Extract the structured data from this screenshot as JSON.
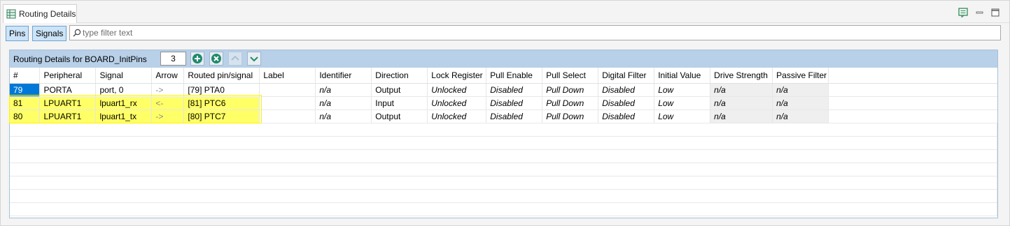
{
  "tab": {
    "title": "Routing Details"
  },
  "toolbar": {
    "pins_label": "Pins",
    "signals_label": "Signals",
    "filter_placeholder": "type filter text"
  },
  "panel": {
    "title": "Routing Details for BOARD_InitPins",
    "count": "3"
  },
  "columns": [
    "#",
    "Peripheral",
    "Signal",
    "Arrow",
    "Routed pin/signal",
    "Label",
    "Identifier",
    "Direction",
    "Lock Register",
    "Pull Enable",
    "Pull Select",
    "Digital Filter",
    "Initial Value",
    "Drive Strength",
    "Passive Filter"
  ],
  "rows": [
    [
      "79",
      "PORTA",
      "port, 0",
      "->",
      "[79] PTA0",
      "",
      "n/a",
      "Output",
      "Unlocked",
      "Disabled",
      "Pull Down",
      "Disabled",
      "Low",
      "n/a",
      "n/a"
    ],
    [
      "81",
      "LPUART1",
      "lpuart1_rx",
      "<-",
      "[81] PTC6",
      "",
      "n/a",
      "Input",
      "Unlocked",
      "Disabled",
      "Pull Down",
      "Disabled",
      "Low",
      "n/a",
      "n/a"
    ],
    [
      "80",
      "LPUART1",
      "lpuart1_tx",
      "->",
      "[80] PTC7",
      "",
      "n/a",
      "Output",
      "Unlocked",
      "Disabled",
      "Pull Down",
      "Disabled",
      "Low",
      "n/a",
      "n/a"
    ]
  ],
  "colors": {
    "highlight": "#ffff66",
    "selection": "#0078d7",
    "header_band": "#b8d0e8"
  }
}
